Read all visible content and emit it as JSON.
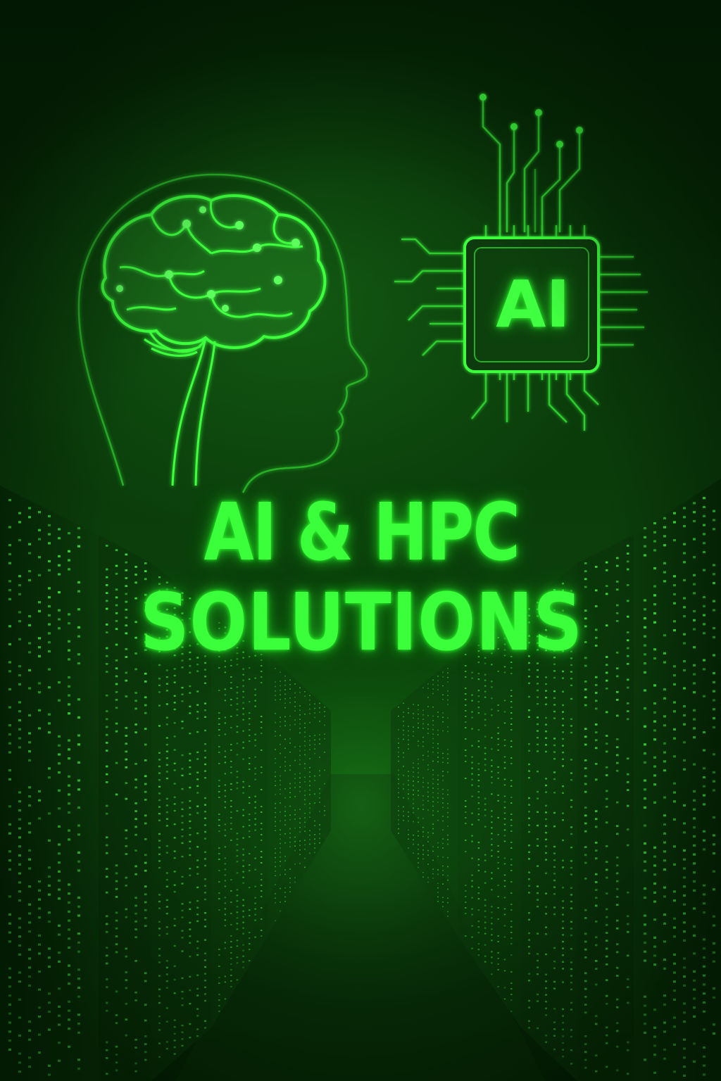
{
  "poster": {
    "title_line1": "AI & HPC",
    "title_line2": "SOLUTIONS",
    "chip_label": "AI"
  },
  "illustrations": {
    "head_icon": "human-head-with-brain",
    "chip_icon": "ai-processor-chip",
    "background": "server-racks-corridor"
  },
  "colors": {
    "glow_green": "#3cff3c",
    "background_dark": "#041804",
    "line_green": "#2ecc2e"
  }
}
